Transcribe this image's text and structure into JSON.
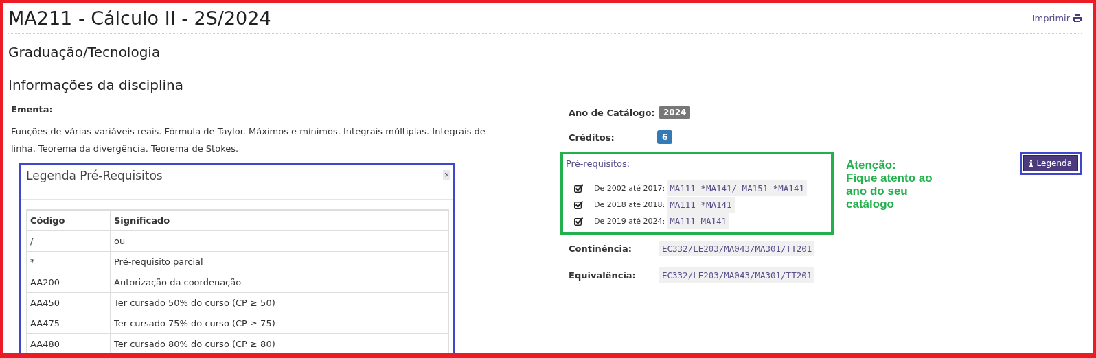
{
  "page": {
    "title": "MA211 - Cálculo II - 2S/2024",
    "print_link": "Imprimir"
  },
  "section_heading": "Graduação/Tecnologia",
  "subsection_heading": "Informações da disciplina",
  "ementa": {
    "label": "Ementa:",
    "text": "Funções de várias variáveis reais. Fórmula de Taylor. Máximos e mínimos. Integrais múltiplas. Integrais de linha. Teorema da divergência. Teorema de Stokes."
  },
  "legend_panel": {
    "title": "Legenda Pré-Requisitos",
    "close": "×",
    "columns": [
      "Código",
      "Significado"
    ],
    "rows": [
      [
        "/",
        "ou"
      ],
      [
        "*",
        "Pré-requisito parcial"
      ],
      [
        "AA200",
        "Autorização da coordenação"
      ],
      [
        "AA450",
        "Ter cursado 50% do curso (CP ≥ 50)"
      ],
      [
        "AA475",
        "Ter cursado 75% do curso (CP ≥ 75)"
      ],
      [
        "AA480",
        "Ter cursado 80% do curso (CP ≥ 80)"
      ]
    ]
  },
  "details": {
    "catalog_year": {
      "label": "Ano de Catálogo:",
      "value": "2024"
    },
    "credits": {
      "label": "Créditos:",
      "value": "6"
    },
    "prerequisites": {
      "label": "Pré-requisitos:",
      "items": [
        {
          "checked": true,
          "period": "De 2002 até 2017:",
          "codes": "MA111 *MA141/ MA151 *MA141"
        },
        {
          "checked": true,
          "period": "De 2018 até 2018:",
          "codes": "MA111 *MA141"
        },
        {
          "checked": true,
          "period": "De 2019 até 2024:",
          "codes": "MA111 MA141"
        }
      ]
    },
    "continencia": {
      "label": "Continência:",
      "value": "EC332/LE203/MA043/MA301/TT201"
    },
    "equivalencia": {
      "label": "Equivalência:",
      "value": "EC332/LE203/MA043/MA301/TT201"
    }
  },
  "note": {
    "title": "Atenção:",
    "text": "Fique atento ao ano do seu catálogo"
  },
  "legend_button": "Legenda"
}
